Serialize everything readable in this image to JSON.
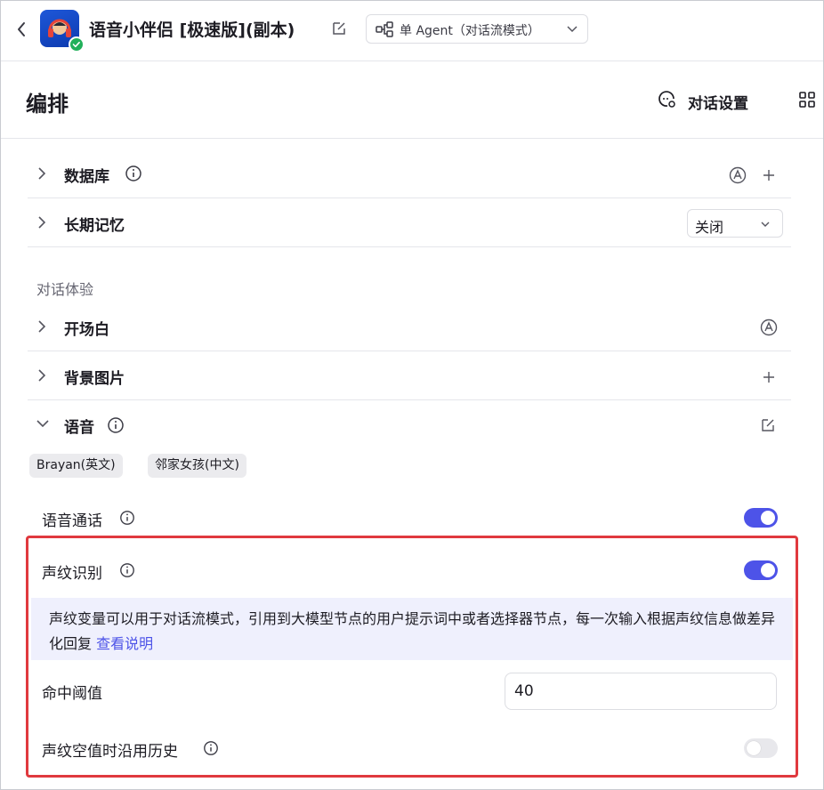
{
  "app": {
    "title": "语音小伴侣 [极速版](副本)",
    "mode_label": "单 Agent（对话流模式）"
  },
  "header": {
    "title": "编排",
    "chat_settings_label": "对话设置"
  },
  "sections": {
    "database": {
      "label": "数据库"
    },
    "long_term_memory": {
      "label": "长期记忆",
      "value": "关闭"
    },
    "experience_label": "对话体验",
    "opening": {
      "label": "开场白"
    },
    "background_image": {
      "label": "背景图片"
    },
    "voice": {
      "label": "语音",
      "tags": [
        "Brayan(英文)",
        "邻家女孩(中文)"
      ]
    }
  },
  "voice_settings": {
    "voice_call": {
      "label": "语音通话",
      "enabled": true
    },
    "voiceprint": {
      "label": "声纹识别",
      "enabled": true
    },
    "description": "声纹变量可以用于对话流模式，引用到大模型节点的用户提示词中或者选择器节点，每一次输入根据声纹信息做差异化回复",
    "description_link": "查看说明",
    "threshold": {
      "label": "命中阈值",
      "value": "40"
    },
    "fallback_history": {
      "label": "声纹空值时沿用历史",
      "enabled": false
    }
  },
  "colors": {
    "accent": "#4d53e8",
    "highlight_border": "#e0393e",
    "description_bg": "#eff0fd"
  }
}
